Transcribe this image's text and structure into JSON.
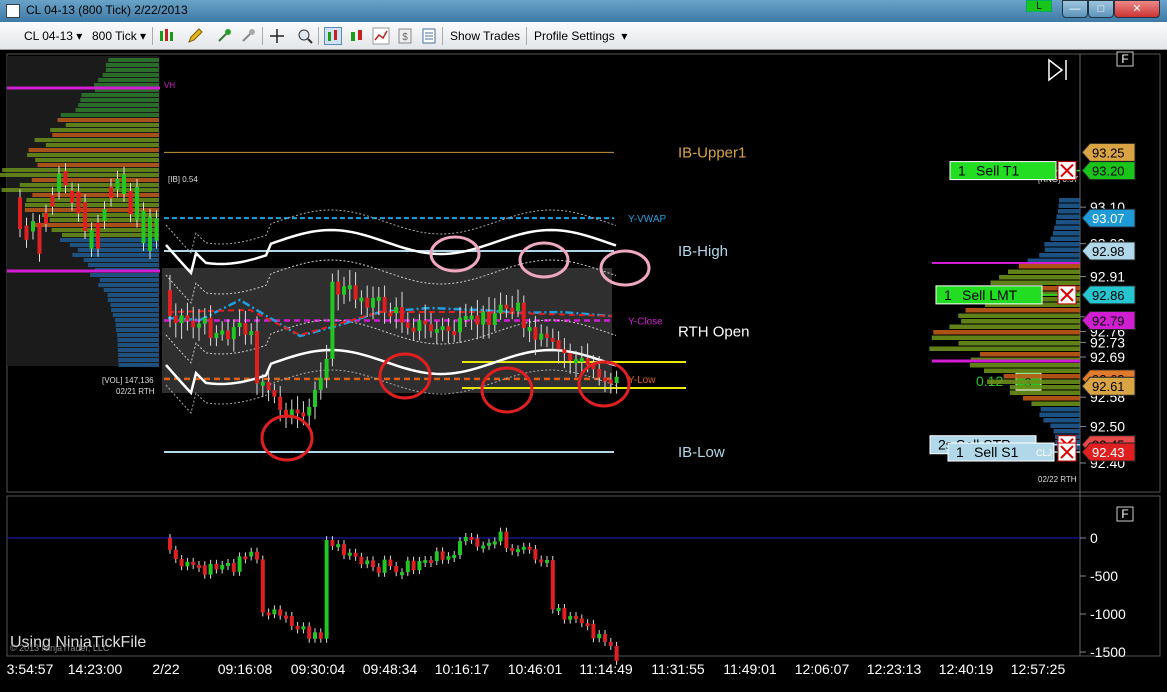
{
  "window": {
    "title": "CL 04-13 (800 Tick)  2/22/2013",
    "badge": "L",
    "minimize": "—",
    "maximize": "□",
    "close": "✕"
  },
  "toolbar": {
    "instrument": "CL 04-13",
    "period": "800 Tick",
    "show_trades": "Show Trades",
    "profile_settings": "Profile Settings"
  },
  "price_panel": {
    "f_label": "F",
    "axis_ticks": [
      {
        "label": "93.10",
        "value": 93.1
      },
      {
        "label": "93.00",
        "value": 93.0
      },
      {
        "label": "92.91",
        "value": 92.91
      },
      {
        "label": "92.80",
        "value": 92.8
      },
      {
        "label": "92.76",
        "value": 92.76
      },
      {
        "label": "92.73",
        "value": 92.73
      },
      {
        "label": "92.69",
        "value": 92.69
      },
      {
        "label": "92.58",
        "value": 92.58
      },
      {
        "label": "92.50",
        "value": 92.5
      },
      {
        "label": "92.40",
        "value": 92.4
      }
    ],
    "price_flags": [
      {
        "label": "93.25",
        "value": 93.25,
        "color": "#d9a443",
        "text": "#000"
      },
      {
        "label": "93.20",
        "value": 93.2,
        "color": "#19c519",
        "text": "#000"
      },
      {
        "label": "93.07",
        "value": 93.07,
        "color": "#1e9ad6",
        "text": "#fff"
      },
      {
        "label": "92.98",
        "value": 92.98,
        "color": "#b0d8e8",
        "text": "#000"
      },
      {
        "label": "92.86",
        "value": 92.86,
        "color": "#26c6d0",
        "text": "#000"
      },
      {
        "label": "92.79",
        "value": 92.79,
        "color": "#d21ed2",
        "text": "#000"
      },
      {
        "label": "92.63",
        "value": 92.63,
        "color": "#e07a2c",
        "text": "#000"
      },
      {
        "label": "92.61",
        "value": 92.61,
        "color": "#d9a443",
        "text": "#000"
      },
      {
        "label": "92.45",
        "value": 92.45,
        "color": "#e84a4a",
        "text": "#000"
      },
      {
        "label": "92.43",
        "value": 92.43,
        "color": "#e02020",
        "text": "#fff"
      }
    ],
    "level_labels": [
      {
        "text": "IB-Upper1",
        "value": 93.25,
        "color": "#d9a443"
      },
      {
        "text": "IB-High",
        "value": 92.98,
        "color": "#b0d8e8"
      },
      {
        "text": "RTH Open",
        "value": 92.76,
        "color": "#ffffff"
      },
      {
        "text": "IB-Low",
        "value": 92.43,
        "color": "#b0d8e8"
      }
    ],
    "small_labels": {
      "vwap": "Y-VWAP",
      "yclose": "Y-Close",
      "ylow": "Y-Low",
      "ib": "[IB] 0.54",
      "rng": "[RNG] 0.57",
      "vh": "VH",
      "vol": "[VOL] 147,136",
      "prev_session": "02/21 RTH",
      "cur_session": "02/22 RTH",
      "cl_tag": "CLJ"
    },
    "orders": {
      "sell_t1": {
        "qty": "1",
        "name": "Sell T1",
        "price": 93.2
      },
      "sell_lmt": {
        "qty": "1",
        "name": "Sell LMT",
        "price": 92.86
      },
      "sell_stp": {
        "qty": "2s",
        "name": "Sell STP",
        "price": 92.45
      },
      "sell_s1": {
        "qty": "1",
        "name": "Sell S1",
        "price": 92.43
      }
    },
    "position": {
      "pnl": "0.12",
      "qty": "3"
    }
  },
  "lower_panel": {
    "f_label": "F",
    "axis_ticks": [
      {
        "label": "0",
        "value": 0
      },
      {
        "label": "-500",
        "value": -500
      },
      {
        "label": "-1000",
        "value": -1000
      },
      {
        "label": "-1500",
        "value": -1500
      }
    ],
    "watermark": "Using NinjaTickFile",
    "copyright": "© 2013 NinjaTrader, LLC"
  },
  "time_axis": [
    "3:54:57",
    "14:23:00",
    "2/22",
    "09:16:08",
    "09:30:04",
    "09:48:34",
    "10:16:17",
    "10:46:01",
    "11:14:49",
    "11:31:55",
    "11:49:01",
    "12:06:07",
    "12:23:13",
    "12:40:19",
    "12:57:25"
  ],
  "colors": {
    "up": "#22c722",
    "down": "#e02020",
    "vwap": "#1ea0e0",
    "yclose": "#d21ed2",
    "ylow": "#e0601a",
    "ib_upper": "#c8973a",
    "ib_line": "#b0d8e8",
    "yellow": "#e8e800",
    "band": "#ffffff",
    "circle_red": "#e02020",
    "circle_pink": "#f0a8c0",
    "zero_line": "#2020c0"
  }
}
